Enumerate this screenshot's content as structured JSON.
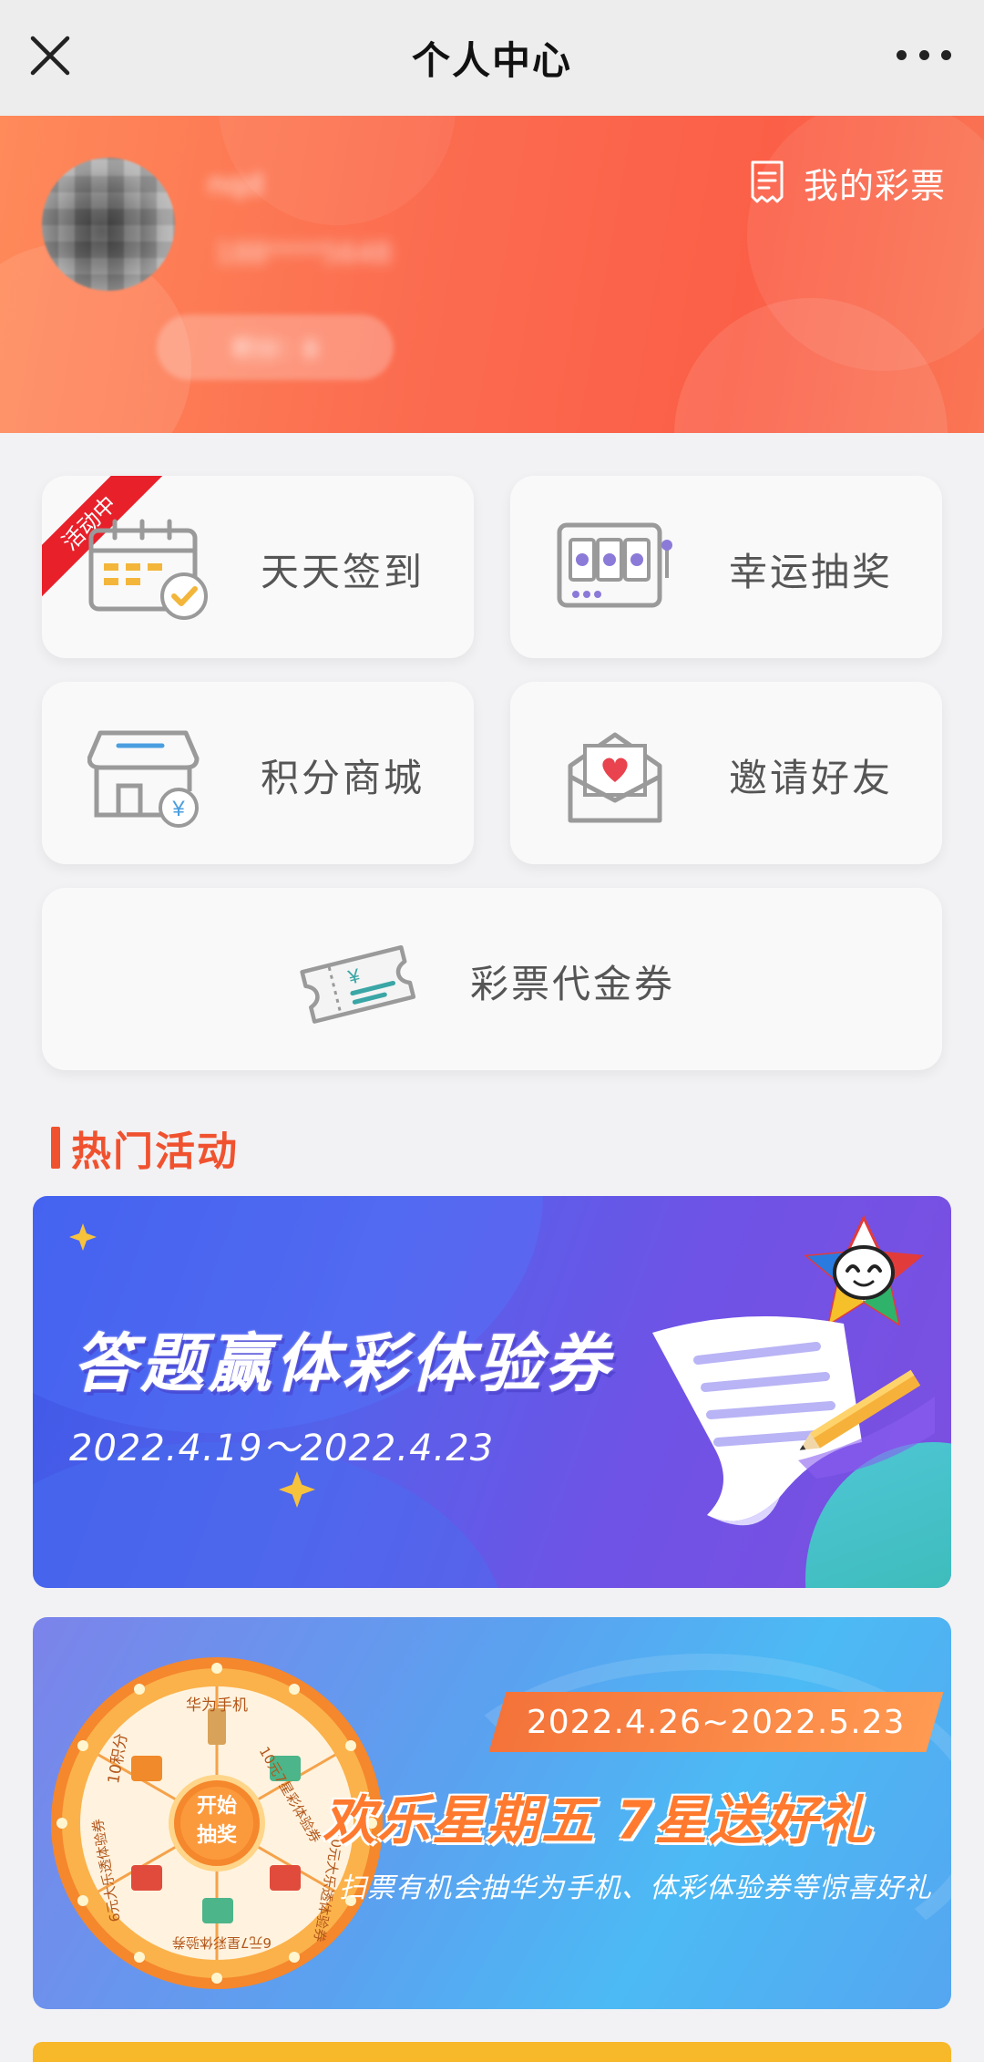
{
  "nav": {
    "title": "个人中心"
  },
  "profile": {
    "username": "nqd",
    "phone": "188****5648",
    "points_pill": "积分：8",
    "my_lottery_label": "我的彩票"
  },
  "menu": {
    "checkin": {
      "label": "天天签到",
      "badge": "活动中"
    },
    "lucky_draw": {
      "label": "幸运抽奖"
    },
    "points_mall": {
      "label": "积分商城"
    },
    "invite_friends": {
      "label": "邀请好友"
    },
    "voucher": {
      "label": "彩票代金券"
    }
  },
  "hot_section": {
    "title": "热门活动"
  },
  "banners": [
    {
      "title": "答题赢体彩体验券",
      "date": "2022.4.19～2022.4.23"
    },
    {
      "date": "2022.4.26~2022.5.23",
      "title": "欢乐星期五  7星送好礼",
      "subtitle": "扫票有机会抽华为手机、体彩体验券等惊喜好礼",
      "wheel": {
        "center": [
          "开始",
          "抽奖"
        ],
        "segments": [
          "华为手机",
          "10元7星彩体验券",
          "10元大乐透体验券",
          "6元7星彩体验券",
          "6元大乐透体验券",
          "10积分"
        ]
      }
    }
  ],
  "colors": {
    "accent": "#f0522f",
    "header_gradient": [
      "#ff8a5a",
      "#fb5f47"
    ],
    "badge_red": "#e8202a"
  }
}
